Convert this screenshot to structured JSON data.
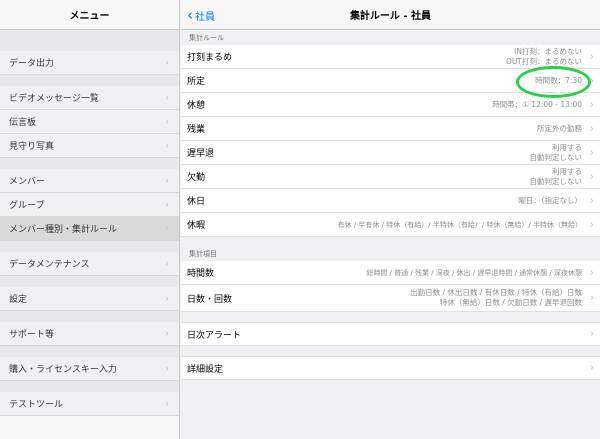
{
  "sidebar": {
    "title": "メニュー",
    "items": [
      {
        "label": "データ出力"
      },
      {
        "label": "ビデオメッセージ一覧"
      },
      {
        "label": "伝言板"
      },
      {
        "label": "見守り写真"
      },
      {
        "label": "メンバー"
      },
      {
        "label": "グループ"
      },
      {
        "label": "メンバー種別・集計ルール"
      },
      {
        "label": "データメンテナンス"
      },
      {
        "label": "設定"
      },
      {
        "label": "サポート等"
      },
      {
        "label": "購入・ライセンスキー入力"
      },
      {
        "label": "テストツール"
      }
    ],
    "selected": "メンバー種別・集計ルール"
  },
  "main": {
    "back_label": "社員",
    "title": "集計ルール - 社員",
    "section1_header": "集計ルール",
    "rules": [
      {
        "label": "打刻まるめ",
        "value_lines": [
          "IN打刻：まるめない",
          "OUT打刻：まるめない"
        ]
      },
      {
        "label": "所定",
        "value_lines": [
          "時間数：7:30"
        ]
      },
      {
        "label": "休憩",
        "value_lines": [
          "時間帯：① 12:00 - 13:00"
        ]
      },
      {
        "label": "残業",
        "value_lines": [
          "所定外の勤務"
        ]
      },
      {
        "label": "遅早退",
        "value_lines": [
          "利用する",
          "自動判定しない"
        ]
      },
      {
        "label": "欠勤",
        "value_lines": [
          "利用する",
          "自動判定しない"
        ]
      },
      {
        "label": "休日",
        "value_lines": [
          "曜日：（指定なし）"
        ]
      },
      {
        "label": "休暇",
        "value_lines": [
          "有休 / 半有休 / 特休（有給）/ 半特休（有給）/ 特休（無給）/ 半特休（無給）"
        ]
      }
    ],
    "section2_header": "集計項目",
    "items": [
      {
        "label": "時間数",
        "value_lines": [
          "総時間 / 普通 / 残業 / 深夜 / 休出 / 遅早退時間 / 通常休憩 / 深夜休憩"
        ]
      },
      {
        "label": "日数・回数",
        "value_lines": [
          "出勤日数 / 休出日数 / 有休日数 / 特休（有給）日数",
          "特休（無給）日数 / 欠勤日数 / 遅早退回数"
        ]
      }
    ],
    "daily_alert_label": "日次アラート",
    "advanced_label": "詳細設定"
  },
  "highlight_color": "#29d04a"
}
